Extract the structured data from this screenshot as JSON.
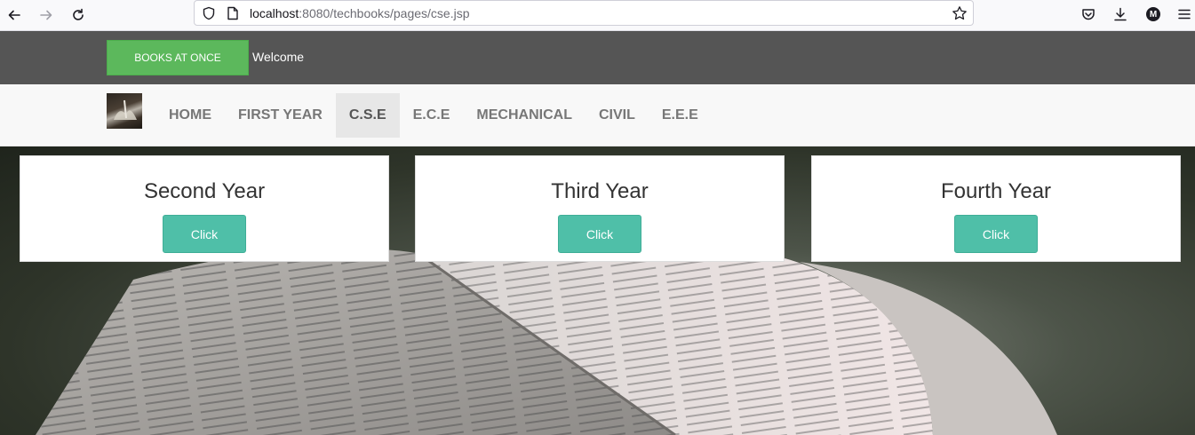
{
  "browser": {
    "url_host": "localhost",
    "url_rest": ":8080/techbooks/pages/cse.jsp",
    "profile_initial": "M"
  },
  "header": {
    "brand_label": "BOOKS AT ONCE",
    "welcome_text": "Welcome"
  },
  "nav": {
    "items": [
      {
        "label": "HOME"
      },
      {
        "label": "FIRST YEAR"
      },
      {
        "label": "C.S.E",
        "active": true
      },
      {
        "label": "E.C.E"
      },
      {
        "label": "MECHANICAL"
      },
      {
        "label": "CIVIL"
      },
      {
        "label": "E.E.E"
      }
    ]
  },
  "cards": [
    {
      "title": "Second Year",
      "button_label": "Click"
    },
    {
      "title": "Third Year",
      "button_label": "Click"
    },
    {
      "title": "Fourth Year",
      "button_label": "Click"
    }
  ],
  "colors": {
    "brand_green": "#5cb85c",
    "topbar_bg": "#555555",
    "card_button": "#4fbfa8"
  },
  "icons": [
    "back-arrow-icon",
    "forward-arrow-icon",
    "reload-icon",
    "shield-icon",
    "page-icon",
    "bookmark-star-icon",
    "pocket-icon",
    "download-icon",
    "account-icon",
    "menu-icon"
  ]
}
